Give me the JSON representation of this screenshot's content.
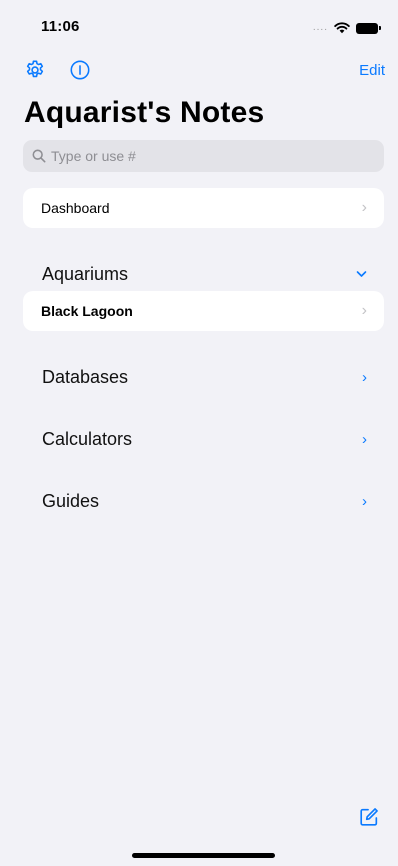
{
  "status_bar": {
    "time": "11:06",
    "signal_dots": "....",
    "icons": [
      "signal-dots",
      "wifi-icon",
      "battery-icon"
    ]
  },
  "nav": {
    "left_icons": [
      "gear-icon",
      "info-icon"
    ],
    "edit_label": "Edit"
  },
  "title": "Aquarist's Notes",
  "search": {
    "placeholder": "Type or use #",
    "value": ""
  },
  "dashboard": {
    "label": "Dashboard"
  },
  "sections": [
    {
      "label": "Aquariums",
      "expanded": true
    },
    {
      "label": "Databases",
      "expanded": false
    },
    {
      "label": "Calculators",
      "expanded": false
    },
    {
      "label": "Guides",
      "expanded": false
    }
  ],
  "aquariums": [
    {
      "label": "Black Lagoon"
    }
  ],
  "icons": {
    "chevron_right": "›",
    "chevron_down": "⌄"
  },
  "colors": {
    "accent": "#0a7aff",
    "background": "#f2f2f7",
    "card": "#ffffff",
    "search_fill": "#e3e3e8"
  }
}
